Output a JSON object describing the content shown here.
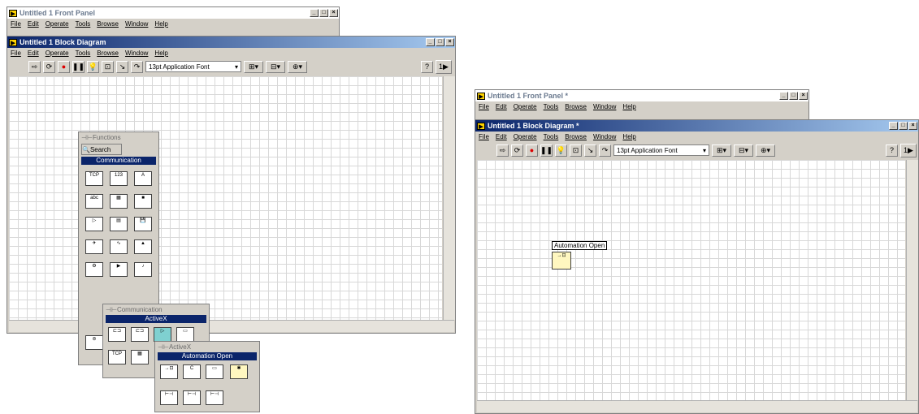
{
  "left": {
    "front_panel": {
      "title": "Untitled 1 Front Panel",
      "menu": [
        "File",
        "Edit",
        "Operate",
        "Tools",
        "Browse",
        "Window",
        "Help"
      ]
    },
    "block_diagram": {
      "title": "Untitled 1 Block Diagram",
      "menu": [
        "File",
        "Edit",
        "Operate",
        "Tools",
        "Browse",
        "Window",
        "Help"
      ],
      "font_select": "13pt Application Font"
    },
    "functions_palette": {
      "title": "Functions",
      "search_label": "Search",
      "category": "Communication"
    },
    "communication_palette": {
      "title": "Communication",
      "category": "ActiveX"
    },
    "activex_palette": {
      "title": "ActiveX",
      "category": "Automation Open"
    }
  },
  "right": {
    "front_panel": {
      "title": "Untitled 1 Front Panel *",
      "menu": [
        "File",
        "Edit",
        "Operate",
        "Tools",
        "Browse",
        "Window",
        "Help"
      ]
    },
    "block_diagram": {
      "title": "Untitled 1 Block Diagram *",
      "menu": [
        "File",
        "Edit",
        "Operate",
        "Tools",
        "Browse",
        "Window",
        "Help"
      ],
      "font_select": "13pt Application Font",
      "node_label": "Automation Open"
    }
  },
  "colors": {
    "active_title": "#0a246a",
    "window_face": "#d4d0c8",
    "palette_category": "#0a246a"
  }
}
